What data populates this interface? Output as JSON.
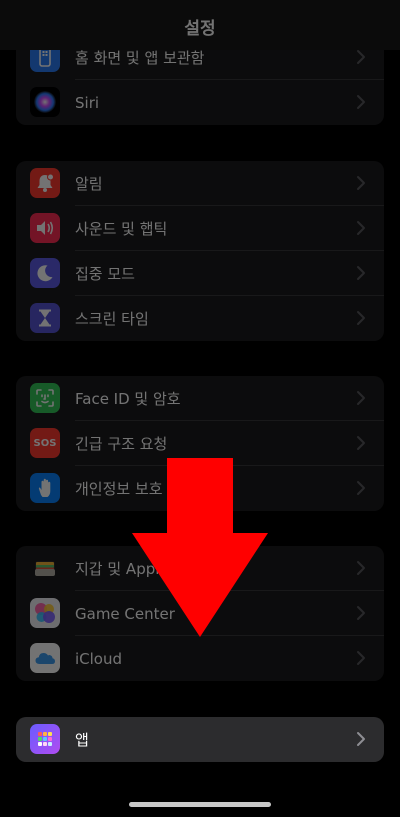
{
  "header": {
    "title": "설정"
  },
  "groups": [
    {
      "items": [
        {
          "label": "홈 화면 및 앱 보관함",
          "icon": "home-screen-icon"
        },
        {
          "label": "Siri",
          "icon": "siri-icon"
        }
      ]
    },
    {
      "items": [
        {
          "label": "알림",
          "icon": "bell-icon"
        },
        {
          "label": "사운드 및 햅틱",
          "icon": "speaker-icon"
        },
        {
          "label": "집중 모드",
          "icon": "moon-icon"
        },
        {
          "label": "스크린 타임",
          "icon": "hourglass-icon"
        }
      ]
    },
    {
      "items": [
        {
          "label": "Face ID 및 암호",
          "icon": "face-id-icon"
        },
        {
          "label": "긴급 구조 요청",
          "icon": "sos-icon"
        },
        {
          "label": "개인정보 보호 및 보안",
          "icon": "hand-icon"
        }
      ]
    },
    {
      "items": [
        {
          "label": "지갑 및 Apple Pay",
          "icon": "wallet-icon"
        },
        {
          "label": "Game Center",
          "icon": "game-center-icon"
        },
        {
          "label": "iCloud",
          "icon": "icloud-icon"
        }
      ]
    },
    {
      "items": [
        {
          "label": "앱",
          "icon": "apps-icon"
        }
      ]
    }
  ],
  "sos_text": "SOS",
  "colors": {
    "highlight_arrow": "#ff0000",
    "group_bg": "#1c1c1e",
    "notifications": "#ff3b30",
    "sounds": "#ff2d55",
    "focus": "#5e5ce6",
    "screen_time": "#5856d6",
    "face_id": "#34c759",
    "sos": "#ff3b30",
    "privacy": "#0a84ff"
  }
}
